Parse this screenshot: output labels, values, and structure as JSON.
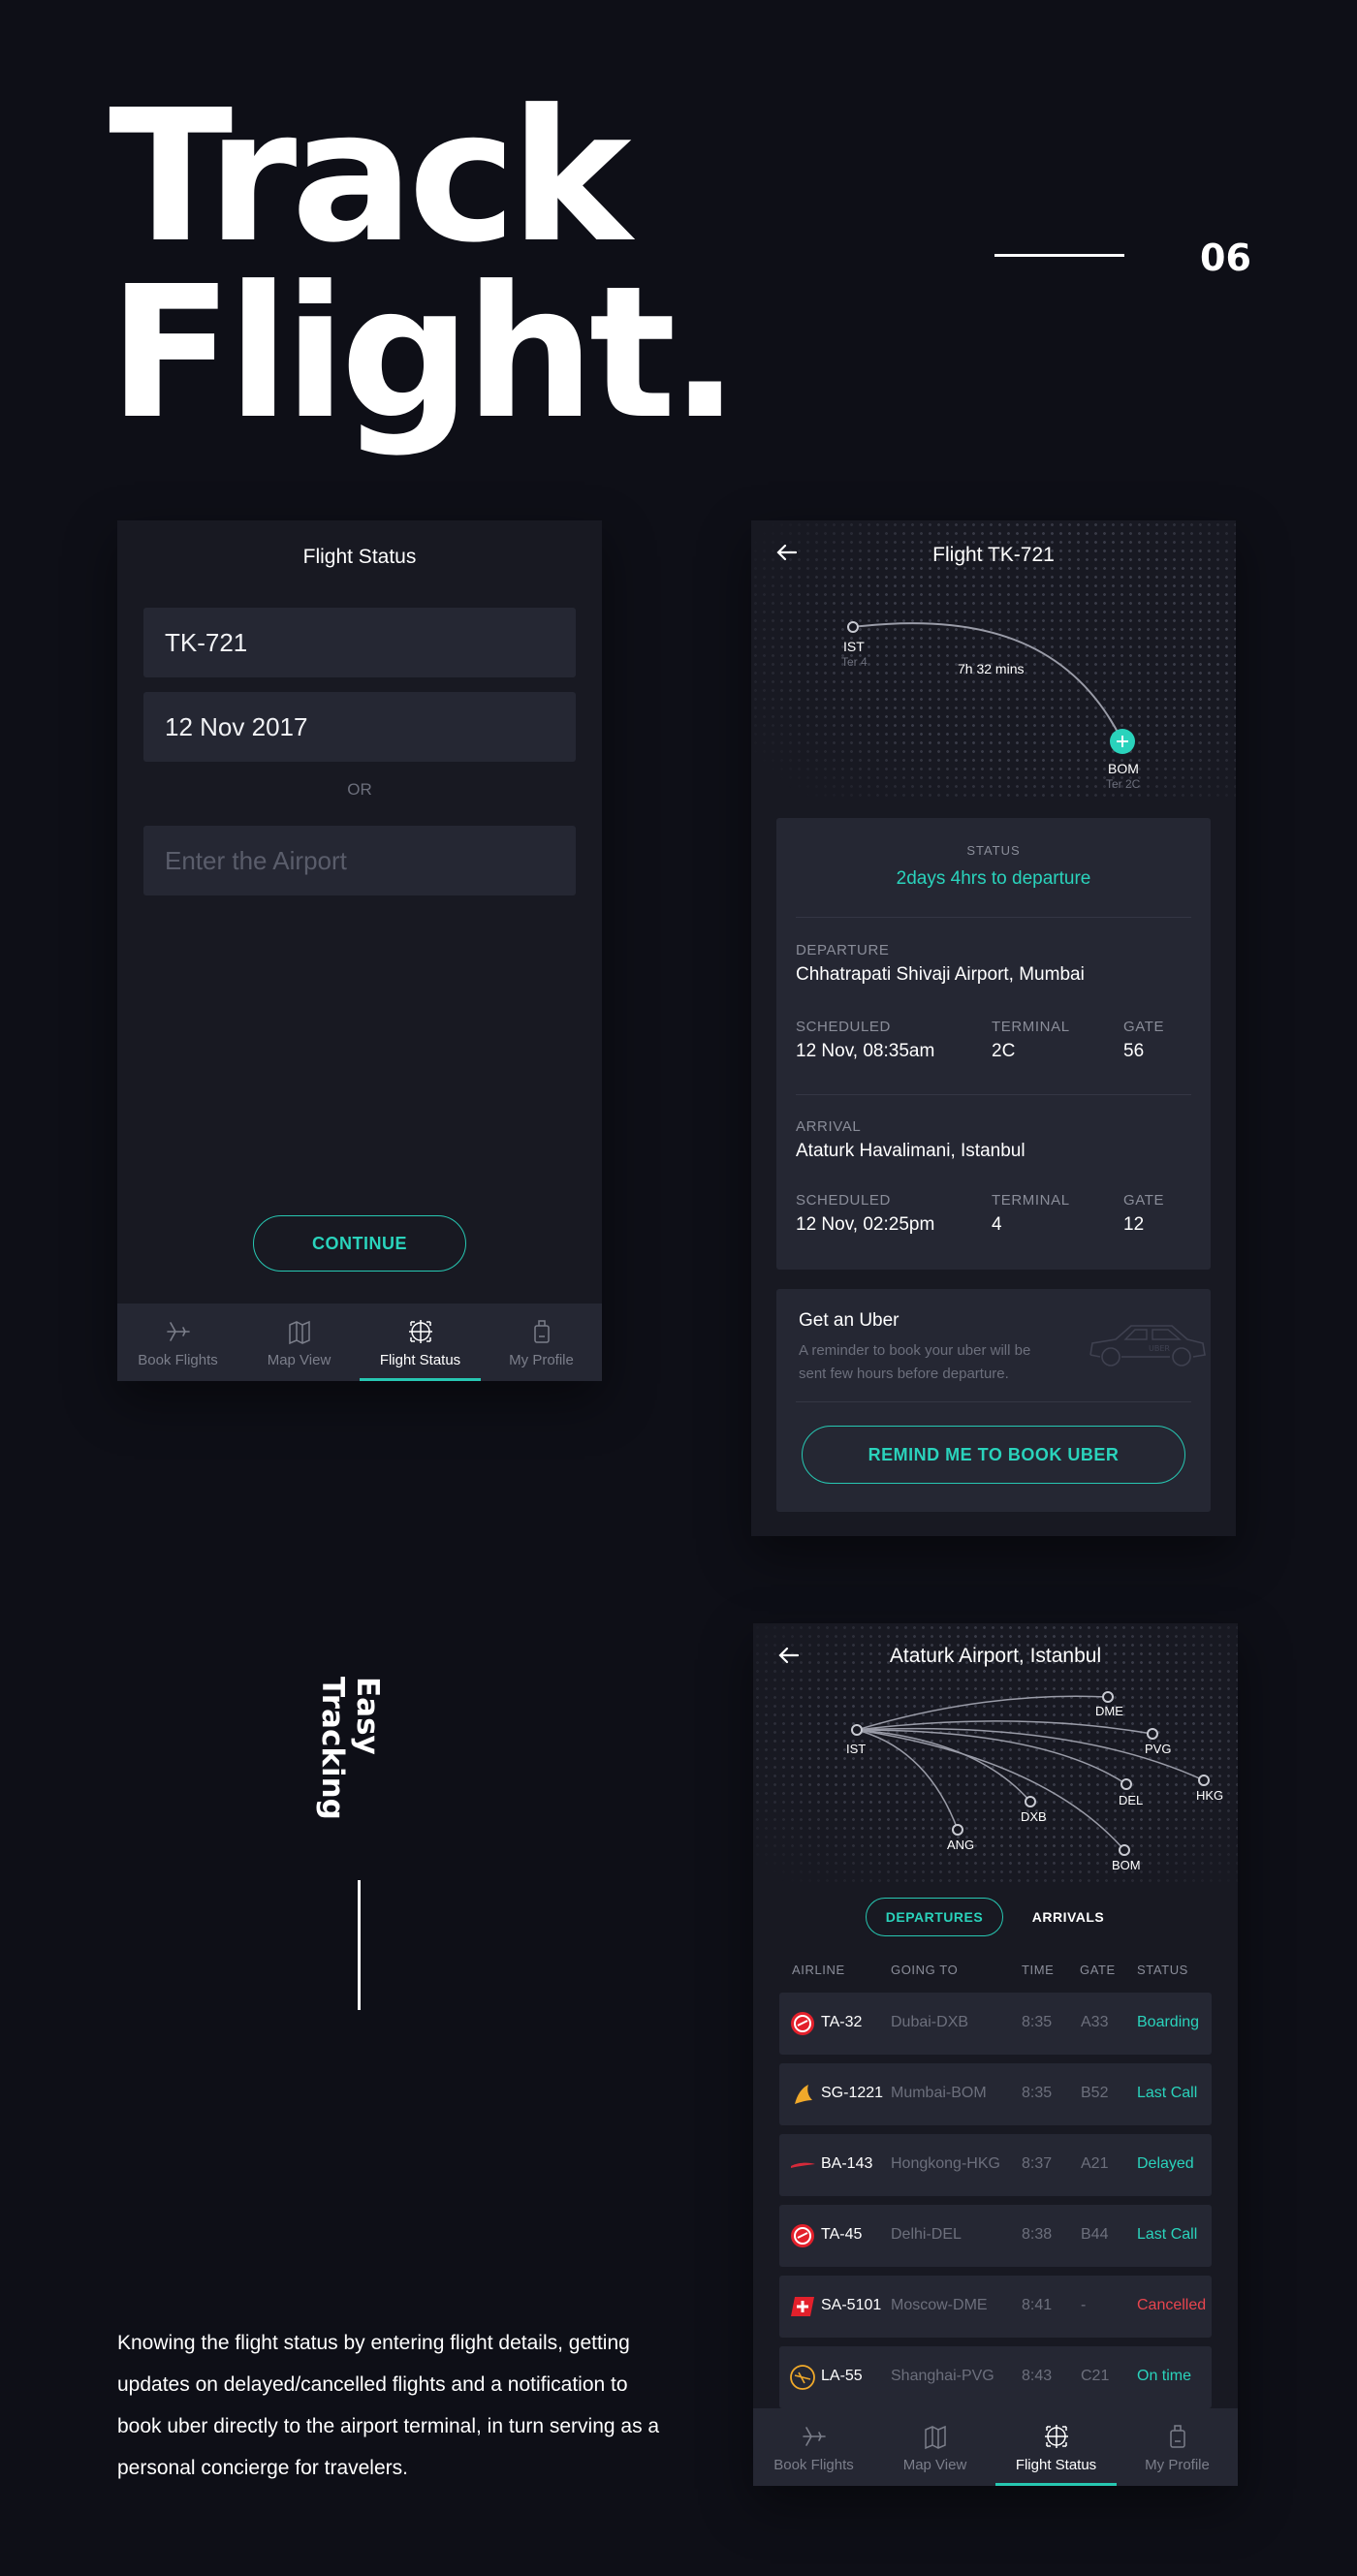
{
  "hero": {
    "line1": "Track",
    "line2": "Flight.",
    "number": "06"
  },
  "side": {
    "vertical_line1": "Easy",
    "vertical_line2": "Tracking",
    "description": "Knowing the flight status by entering flight details, getting updates on delayed/cancelled flights and a notification to book uber directly to the airport terminal, in turn serving as a personal concierge for travelers."
  },
  "screen1": {
    "title": "Flight Status",
    "flight_value": "TK-721",
    "date_value": "12 Nov 2017",
    "or_label": "OR",
    "airport_placeholder": "Enter the Airport",
    "continue_label": "CONTINUE"
  },
  "tabs": [
    {
      "label": "Book Flights",
      "icon": "plane-icon"
    },
    {
      "label": "Map View",
      "icon": "map-icon"
    },
    {
      "label": "Flight Status",
      "icon": "radar-icon",
      "active": true
    },
    {
      "label": "My Profile",
      "icon": "luggage-icon"
    }
  ],
  "screen2": {
    "title": "Flight TK-721",
    "map": {
      "from_code": "IST",
      "from_terminal": "Ter 4",
      "to_code": "BOM",
      "to_terminal": "Ter 2C",
      "duration": "7h 32 mins"
    },
    "status_label": "STATUS",
    "status_value": "2days 4hrs to departure",
    "departure": {
      "label": "DEPARTURE",
      "airport": "Chhatrapati Shivaji Airport, Mumbai",
      "scheduled_label": "SCHEDULED",
      "scheduled": "12 Nov, 08:35am",
      "terminal_label": "TERMINAL",
      "terminal": "2C",
      "gate_label": "GATE",
      "gate": "56"
    },
    "arrival": {
      "label": "ARRIVAL",
      "airport": "Ataturk Havalimani, Istanbul",
      "scheduled_label": "SCHEDULED",
      "scheduled": "12 Nov, 02:25pm",
      "terminal_label": "TERMINAL",
      "terminal": "4",
      "gate_label": "GATE",
      "gate": "12"
    },
    "uber": {
      "title": "Get an Uber",
      "text_line1": "A reminder to book your uber will be",
      "text_line2": "sent few hours before departure.",
      "car_text": "UBER",
      "button": "REMIND ME TO BOOK UBER"
    }
  },
  "screen3": {
    "title": "Ataturk Airport, Istanbul",
    "map": {
      "origin": "IST",
      "destinations": [
        "DME",
        "PVG",
        "HKG",
        "DEL",
        "DXB",
        "ANG",
        "BOM"
      ]
    },
    "tab_departures": "DEPARTURES",
    "tab_arrivals": "ARRIVALS",
    "headers": {
      "airline": "AIRLINE",
      "going_to": "GOING TO",
      "time": "TIME",
      "gate": "GATE",
      "status": "STATUS"
    },
    "rows": [
      {
        "flight": "TA-32",
        "dest": "Dubai-DXB",
        "time": "8:35",
        "gate": "A33",
        "status": "Boarding",
        "status_color": "#2ad3bc",
        "logo": "turkish-airlines-logo"
      },
      {
        "flight": "SG-1221",
        "dest": "Mumbai-BOM",
        "time": "8:35",
        "gate": "B52",
        "status": "Last Call",
        "status_color": "#2ad3bc",
        "logo": "singapore-airlines-logo"
      },
      {
        "flight": "BA-143",
        "dest": "Hongkong-HKG",
        "time": "8:37",
        "gate": "A21",
        "status": "Delayed",
        "status_color": "#2ad3bc",
        "logo": "british-airways-logo"
      },
      {
        "flight": "TA-45",
        "dest": "Delhi-DEL",
        "time": "8:38",
        "gate": "B44",
        "status": "Last Call",
        "status_color": "#2ad3bc",
        "logo": "turkish-airlines-logo"
      },
      {
        "flight": "SA-5101",
        "dest": "Moscow-DME",
        "time": "8:41",
        "gate": "-",
        "status": "Cancelled",
        "status_color": "#e8454e",
        "logo": "swiss-logo"
      },
      {
        "flight": "LA-55",
        "dest": "Shanghai-PVG",
        "time": "8:43",
        "gate": "C21",
        "status": "On time",
        "status_color": "#2ad3bc",
        "logo": "lufthansa-logo"
      }
    ]
  },
  "colors": {
    "background": "#0e0f17",
    "panel": "#181922",
    "field": "#252733",
    "accent": "#27c7b2",
    "danger": "#e8454e"
  }
}
